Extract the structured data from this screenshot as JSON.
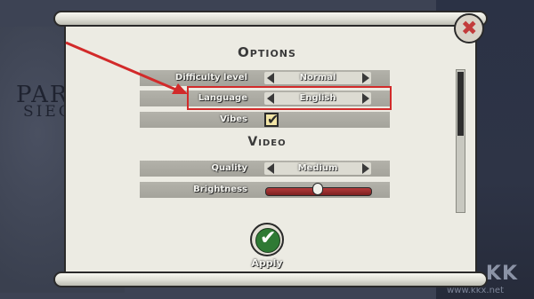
{
  "background": {
    "title": "PAR",
    "subtitle": "SIEG",
    "watermark": "KK",
    "watermark_url": "www.kkx.net"
  },
  "options": {
    "title": "Options",
    "difficulty": {
      "label": "Difficulty level",
      "value": "Normal"
    },
    "language": {
      "label": "Language",
      "value": "English"
    },
    "vibes": {
      "label": "Vibes",
      "checked": true
    }
  },
  "video": {
    "title": "Video",
    "quality": {
      "label": "Quality",
      "value": "Medium"
    },
    "brightness": {
      "label": "Brightness",
      "level": 0.5
    }
  },
  "apply": {
    "label": "Apply"
  },
  "colors": {
    "highlight": "#d22a2a",
    "apply_green": "#2f7a34",
    "close_red": "#c23b3b"
  },
  "icons": {
    "close": "close-icon",
    "apply": "check-icon",
    "vibes": "checkmark-icon"
  }
}
